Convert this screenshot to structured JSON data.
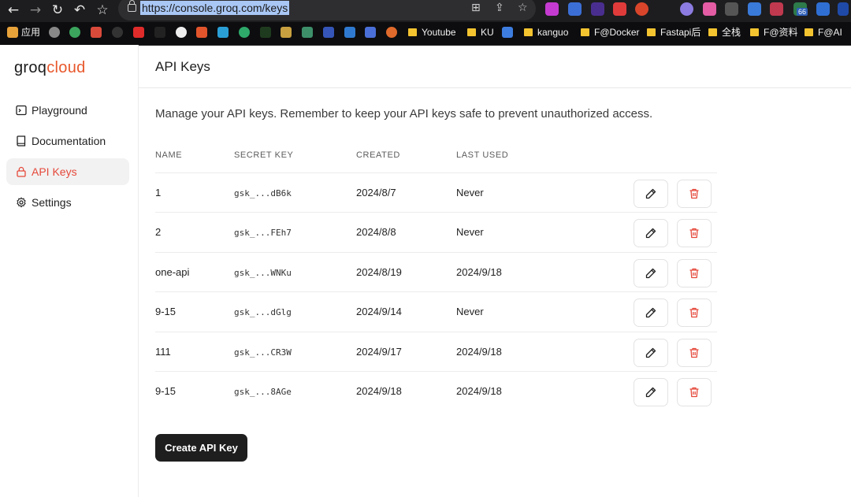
{
  "browser": {
    "url": "https://console.groq.com/keys",
    "bookmarks": {
      "apps": "应用",
      "youtube": "Youtube",
      "ku": "KU",
      "kanguo": "kanguo",
      "fdocker": "F@Docker",
      "fastapi": "Fastapi后",
      "quanzhan": "全栈",
      "fziliao": "F@资料",
      "fai": "F@AI"
    },
    "extension_badge": "66"
  },
  "sidebar": {
    "logo_main": "groq",
    "logo_accent": "cloud",
    "items": [
      {
        "label": "Playground",
        "icon": "terminal-icon"
      },
      {
        "label": "Documentation",
        "icon": "book-icon"
      },
      {
        "label": "API Keys",
        "icon": "lock-icon",
        "active": true
      },
      {
        "label": "Settings",
        "icon": "gear-icon"
      }
    ]
  },
  "main": {
    "title": "API Keys",
    "description": "Manage your API keys. Remember to keep your API keys safe to prevent unauthorized access.",
    "columns": [
      "NAME",
      "SECRET KEY",
      "CREATED",
      "LAST USED"
    ],
    "rows": [
      {
        "name": "1",
        "key": "gsk_...dB6k",
        "created": "2024/8/7",
        "last_used": "Never"
      },
      {
        "name": "2",
        "key": "gsk_...FEh7",
        "created": "2024/8/8",
        "last_used": "Never"
      },
      {
        "name": "one-api",
        "key": "gsk_...WNKu",
        "created": "2024/8/19",
        "last_used": "2024/9/18"
      },
      {
        "name": "9-15",
        "key": "gsk_...dGlg",
        "created": "2024/9/14",
        "last_used": "Never"
      },
      {
        "name": "111",
        "key": "gsk_...CR3W",
        "created": "2024/9/17",
        "last_used": "2024/9/18"
      },
      {
        "name": "9-15",
        "key": "gsk_...8AGe",
        "created": "2024/9/18",
        "last_used": "2024/9/18"
      }
    ],
    "create_button": "Create API Key"
  },
  "colors": {
    "accent": "#e5483a",
    "button_dark": "#1e1e1e",
    "active_bg": "#f2f2f2"
  }
}
